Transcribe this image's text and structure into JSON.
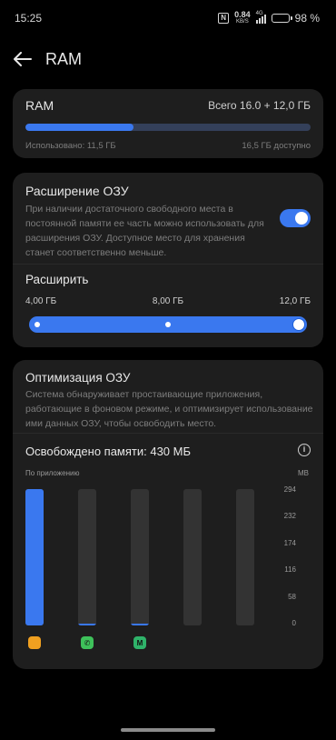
{
  "status_bar": {
    "time": "15:25",
    "nfc": "N",
    "net_speed_value": "0.84",
    "net_speed_unit": "KB/S",
    "network_type": "4G",
    "battery": "98 %"
  },
  "header": {
    "title": "RAM",
    "back_icon": "arrow-left-icon"
  },
  "ram": {
    "title": "RAM",
    "total": "Всего 16.0 + 12,0 ГБ",
    "used_label": "Использовано: 11,5 ГБ",
    "available_label": "16,5 ГБ доступно",
    "used_fraction": 0.38,
    "accent": "#3a78ef"
  },
  "expansion": {
    "title": "Расширение ОЗУ",
    "description": "При наличии достаточного свободного места в постоянной памяти ее часть можно использовать для расширения ОЗУ. Доступное место для хранения станет соответственно меньше.",
    "enabled": true,
    "expand_label": "Расширить",
    "options": [
      "4,00 ГБ",
      "8,00 ГБ",
      "12,0 ГБ"
    ],
    "selected": "12,0 ГБ"
  },
  "optimization": {
    "title": "Оптимизация ОЗУ",
    "description": "Система обнаруживает простаивающие приложения, работающие в фоновом режиме, и оптимизирует использование ими данных ОЗУ, чтобы освободить место.",
    "freed_label": "Освобождено памяти: 430 МБ",
    "info_icon": "info-icon"
  },
  "chart_data": {
    "type": "bar",
    "title": "",
    "xlabel": "По приложению",
    "ylabel": "MB",
    "ylim": [
      0,
      294
    ],
    "yticks": [
      "294",
      "232",
      "174",
      "116",
      "58",
      "0"
    ],
    "categories": [
      "app-1",
      "whatsapp",
      "app-3",
      "",
      ""
    ],
    "values": [
      294,
      4,
      4,
      0,
      0
    ],
    "color": "#3a78ef",
    "track_color": "#333333"
  },
  "app_icons": [
    {
      "name": "app-1-icon",
      "glyph": "",
      "color": "#f0a020",
      "x": 0
    },
    {
      "name": "whatsapp-icon",
      "glyph": "✆",
      "color": "#3ec15a",
      "x": 1
    },
    {
      "name": "app-3-icon",
      "glyph": "M",
      "color": "#2fb36a",
      "x": 2
    }
  ]
}
